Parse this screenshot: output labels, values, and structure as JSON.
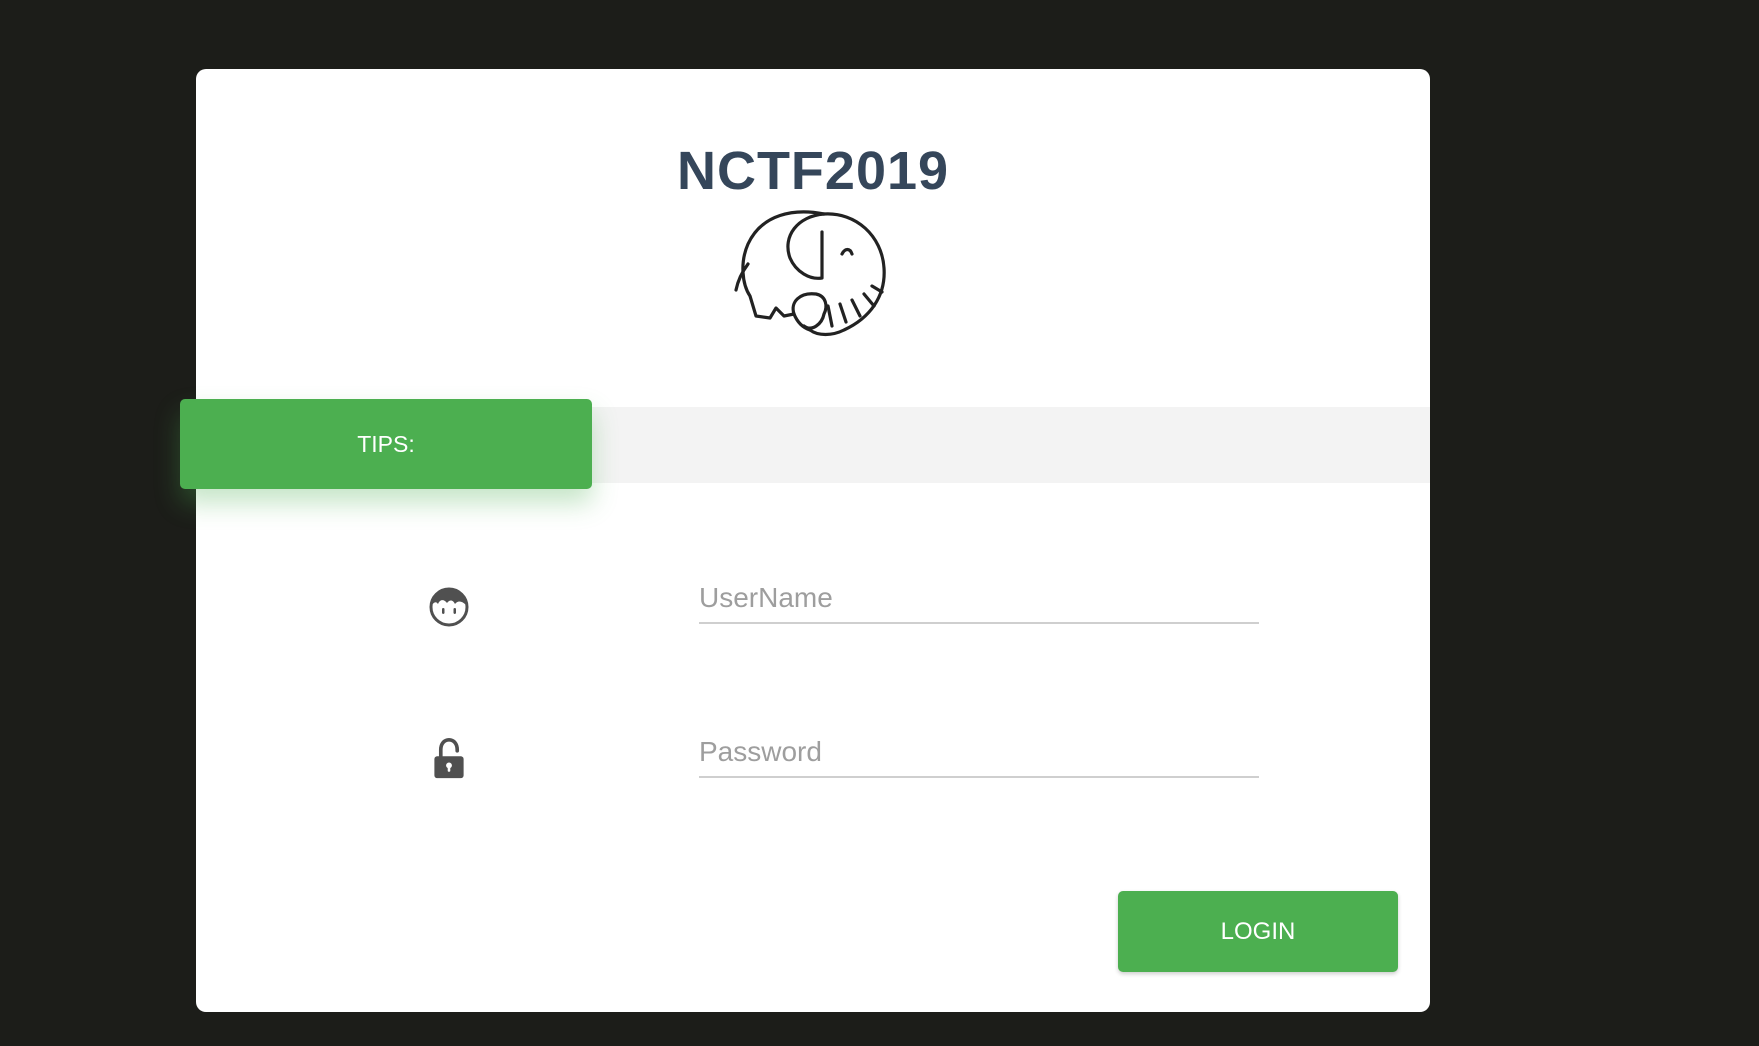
{
  "title": "NCTF2019",
  "tips": {
    "label": "TIPS:"
  },
  "form": {
    "username": {
      "placeholder": "UserName",
      "value": "",
      "icon": "user-face-icon"
    },
    "password": {
      "placeholder": "Password",
      "value": "",
      "icon": "unlock-icon"
    },
    "login_label": "LOGIN"
  },
  "logo": {
    "icon": "elephant-icon"
  },
  "colors": {
    "background": "#1c1d19",
    "card": "#ffffff",
    "accent": "#4caf50",
    "title": "#35465a",
    "tips_bar": "#f3f3f3"
  }
}
